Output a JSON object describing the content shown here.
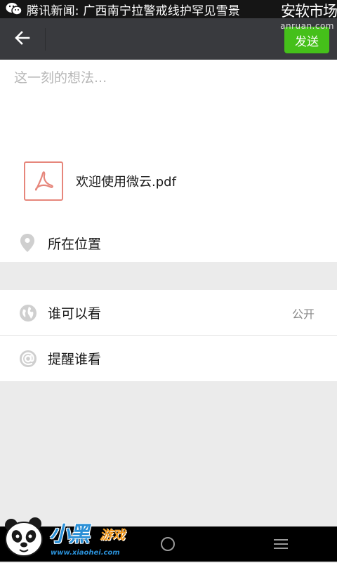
{
  "status_bar": {
    "app_icon": "wechat-icon",
    "notification": "腾讯新闻: 广西南宁拉警戒线护罕见雪景"
  },
  "watermark": {
    "title": "安软市场",
    "url": "anruan.com"
  },
  "top_bar": {
    "back_icon": "arrow-left-icon",
    "send_label": "发送",
    "accent_color": "#45c01a"
  },
  "compose": {
    "placeholder": "这一刻的想法...",
    "value": "",
    "attachment": {
      "icon": "pdf-icon",
      "file_name": "欢迎使用微云.pdf"
    },
    "location": {
      "icon": "location-pin-icon",
      "label": "所在位置"
    }
  },
  "options": [
    {
      "icon": "globe-icon",
      "label": "谁可以看",
      "value": "公开"
    },
    {
      "icon": "at-icon",
      "label": "提醒谁看",
      "value": ""
    }
  ],
  "brand_badge": {
    "name": "小黑",
    "suffix": "游戏",
    "url": "www.xiaohei.com"
  },
  "nav_bar": {
    "home_icon": "home-circle-icon",
    "menu_icon": "menu-icon"
  }
}
